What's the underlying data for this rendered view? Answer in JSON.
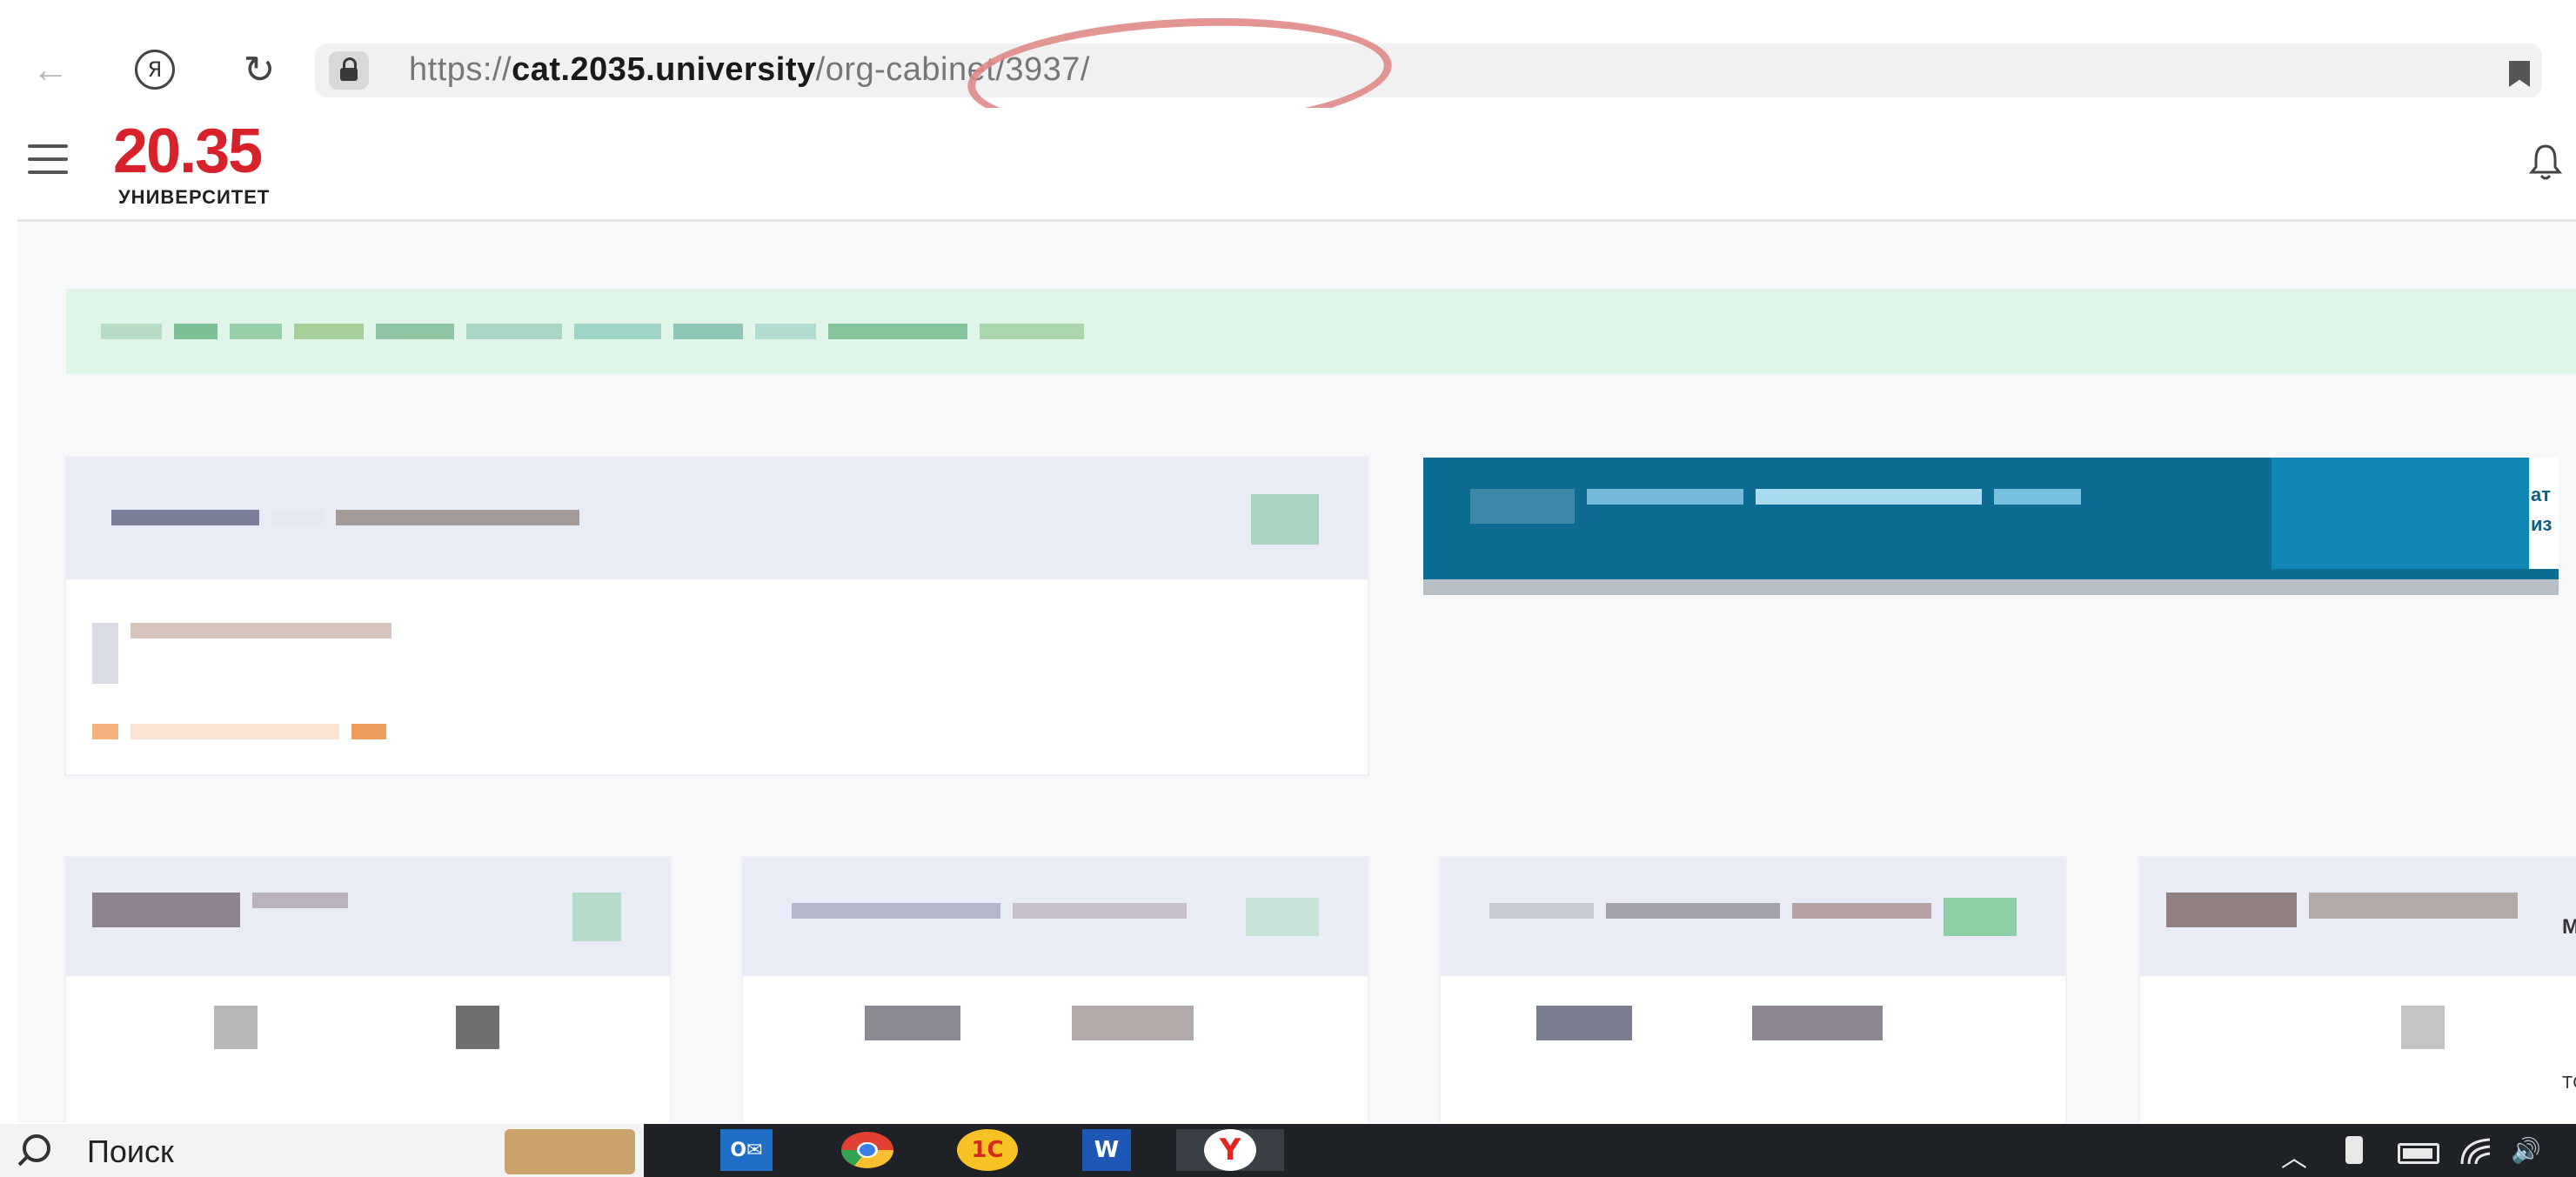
{
  "browser": {
    "url_scheme": "https://",
    "url_host": "cat.2035.university",
    "url_path": "/org-cabinet/3937/",
    "back_glyph": "←",
    "yandex_glyph": "Я",
    "reload_glyph": "↻",
    "icons": [
      "back-arrow-icon",
      "yandex-icon",
      "reload-icon",
      "lock-icon",
      "bookmark-icon"
    ]
  },
  "site": {
    "logo_number": "20.35",
    "logo_caption": "УНИВЕРСИТЕТ",
    "brand_color": "#d8222b",
    "icons": [
      "hamburger-menu-icon",
      "bell-icon"
    ]
  },
  "blue_card": {
    "edge_line1": "ат",
    "edge_line2": "из"
  },
  "edge_labels": {
    "card4_right": "МІ",
    "card4_bottom": "ТС"
  },
  "taskbar": {
    "search_label": "Поиск",
    "apps": [
      "outlook-icon",
      "chrome-icon",
      "1c-icon",
      "word-icon",
      "yandex-browser-icon"
    ],
    "app_outlook": "O✉",
    "app_1c": "1С",
    "app_word": "W",
    "app_yandex": "Y",
    "tray": {
      "chevron": "︿",
      "volume": "🔊"
    }
  },
  "colors": {
    "banner_bg": "#e1f4e8",
    "card_header_bg": "#e9ebf7",
    "blue_card_bg": "#0d6c93",
    "taskbar_bg": "#1e2126",
    "annotation_circle": "#e08a88"
  }
}
